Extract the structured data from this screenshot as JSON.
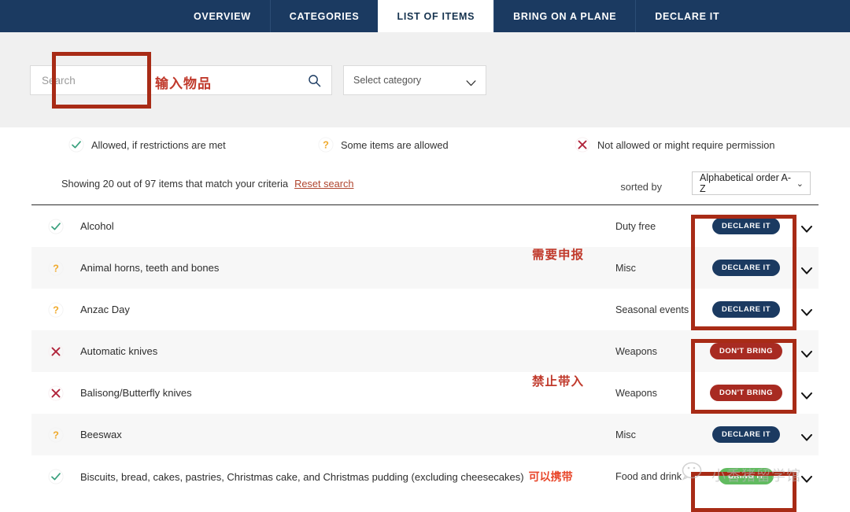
{
  "nav": {
    "tabs": [
      {
        "label": "OVERVIEW",
        "active": false
      },
      {
        "label": "CATEGORIES",
        "active": false
      },
      {
        "label": "LIST OF ITEMS",
        "active": true
      },
      {
        "label": "BRING ON A PLANE",
        "active": false
      },
      {
        "label": "DECLARE IT",
        "active": false
      }
    ]
  },
  "search": {
    "placeholder": "Search",
    "annotation_cn": "输入物品",
    "icon": "search-icon",
    "category_select": {
      "value": "Select category",
      "icon": "chevron-down-icon"
    }
  },
  "legend": [
    {
      "icon": "check-icon",
      "label": "Allowed, if restrictions are met",
      "color": "#3aa17e"
    },
    {
      "icon": "question-icon",
      "label": "Some items are allowed",
      "color": "#f0ab2e"
    },
    {
      "icon": "cross-icon",
      "label": "Not allowed or might require permission",
      "color": "#b0233a"
    }
  ],
  "results": {
    "summary": "Showing 20 out of 97 items that match your criteria",
    "reset_label": "Reset search",
    "sorted_by_label": "sorted by",
    "sort_value": "Alphabetical order A-Z",
    "sort_caret": "chevron-down-icon"
  },
  "annotations": {
    "declare_cn": "需要申报",
    "dont_bring_cn": "禁止带入",
    "bring_it_cn": "可以携带"
  },
  "watermark": {
    "text": "小香猪留学馆",
    "icon": "wechat-icon"
  },
  "colors": {
    "nav_bg": "#1b3a61",
    "declare_pill": "#1b3a61",
    "dont_bring_pill": "#a82b22",
    "bring_it_pill": "#61bb60",
    "highlight_box": "#a82b16",
    "annotation_text": "#c0392b"
  },
  "rows": [
    {
      "status": "check-icon",
      "name": "Alcohol",
      "cn": "",
      "category": "Duty free",
      "action": "DECLARE IT",
      "action_type": "declare",
      "chevron": "chevron-down-icon"
    },
    {
      "status": "question-icon",
      "name": "Animal horns, teeth and bones",
      "cn": "",
      "category": "Misc",
      "action": "DECLARE IT",
      "action_type": "declare",
      "chevron": "chevron-down-icon"
    },
    {
      "status": "question-icon",
      "name": "Anzac Day",
      "cn": "",
      "category": "Seasonal events",
      "action": "DECLARE IT",
      "action_type": "declare",
      "chevron": "chevron-down-icon"
    },
    {
      "status": "cross-icon",
      "name": "Automatic knives",
      "cn": "",
      "category": "Weapons",
      "action": "DON'T BRING",
      "action_type": "dontbring",
      "chevron": "chevron-down-icon"
    },
    {
      "status": "cross-icon",
      "name": "Balisong/Butterfly knives",
      "cn": "",
      "category": "Weapons",
      "action": "DON'T BRING",
      "action_type": "dontbring",
      "chevron": "chevron-down-icon"
    },
    {
      "status": "question-icon",
      "name": "Beeswax",
      "cn": "",
      "category": "Misc",
      "action": "DECLARE IT",
      "action_type": "declare",
      "chevron": "chevron-down-icon"
    },
    {
      "status": "check-icon",
      "name": "Biscuits, bread, cakes, pastries, Christmas cake, and Christmas pudding (excluding cheesecakes)",
      "cn": "可以携带",
      "category": "Food and drink",
      "action": "BRING IT",
      "action_type": "bringit",
      "chevron": "chevron-down-icon"
    }
  ]
}
